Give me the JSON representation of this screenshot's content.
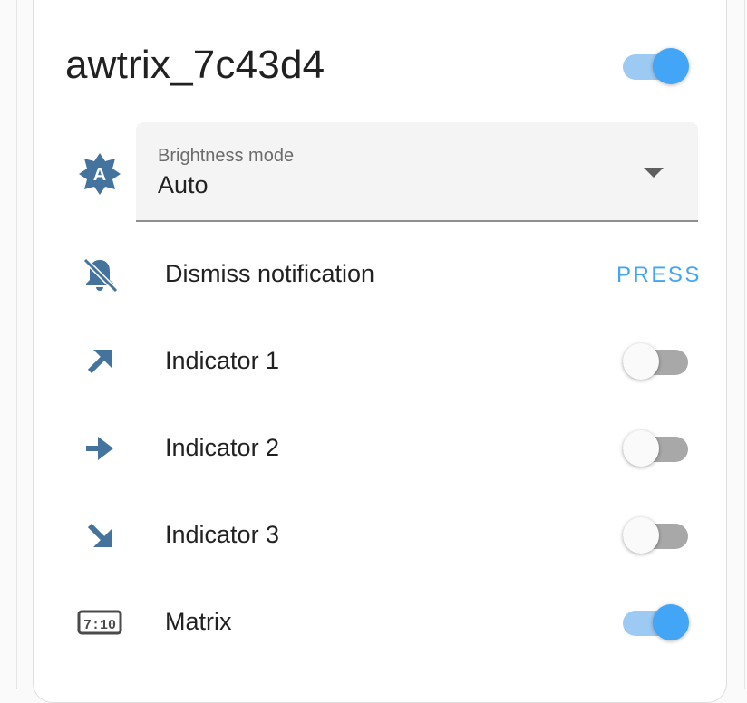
{
  "card": {
    "title": "awtrix_7c43d4",
    "master_toggle": {
      "state": "on"
    }
  },
  "brightness": {
    "icon": "brightness-auto-icon",
    "label": "Brightness mode",
    "value": "Auto"
  },
  "rows": [
    {
      "icon": "bell-off-icon",
      "label": "Dismiss notification",
      "action": "PRESS"
    },
    {
      "icon": "arrow-top-right-icon",
      "label": "Indicator 1",
      "toggle": "off"
    },
    {
      "icon": "arrow-right-icon",
      "label": "Indicator 2",
      "toggle": "off"
    },
    {
      "icon": "arrow-bottom-right-icon",
      "label": "Indicator 3",
      "toggle": "off"
    },
    {
      "icon": "clock-digital-icon",
      "label": "Matrix",
      "toggle": "on"
    }
  ],
  "colors": {
    "icon": "#44739e",
    "accent": "#42a5f5",
    "accent_track": "#9ccaf2",
    "off_track": "#a8a8a8",
    "text": "#212121"
  }
}
